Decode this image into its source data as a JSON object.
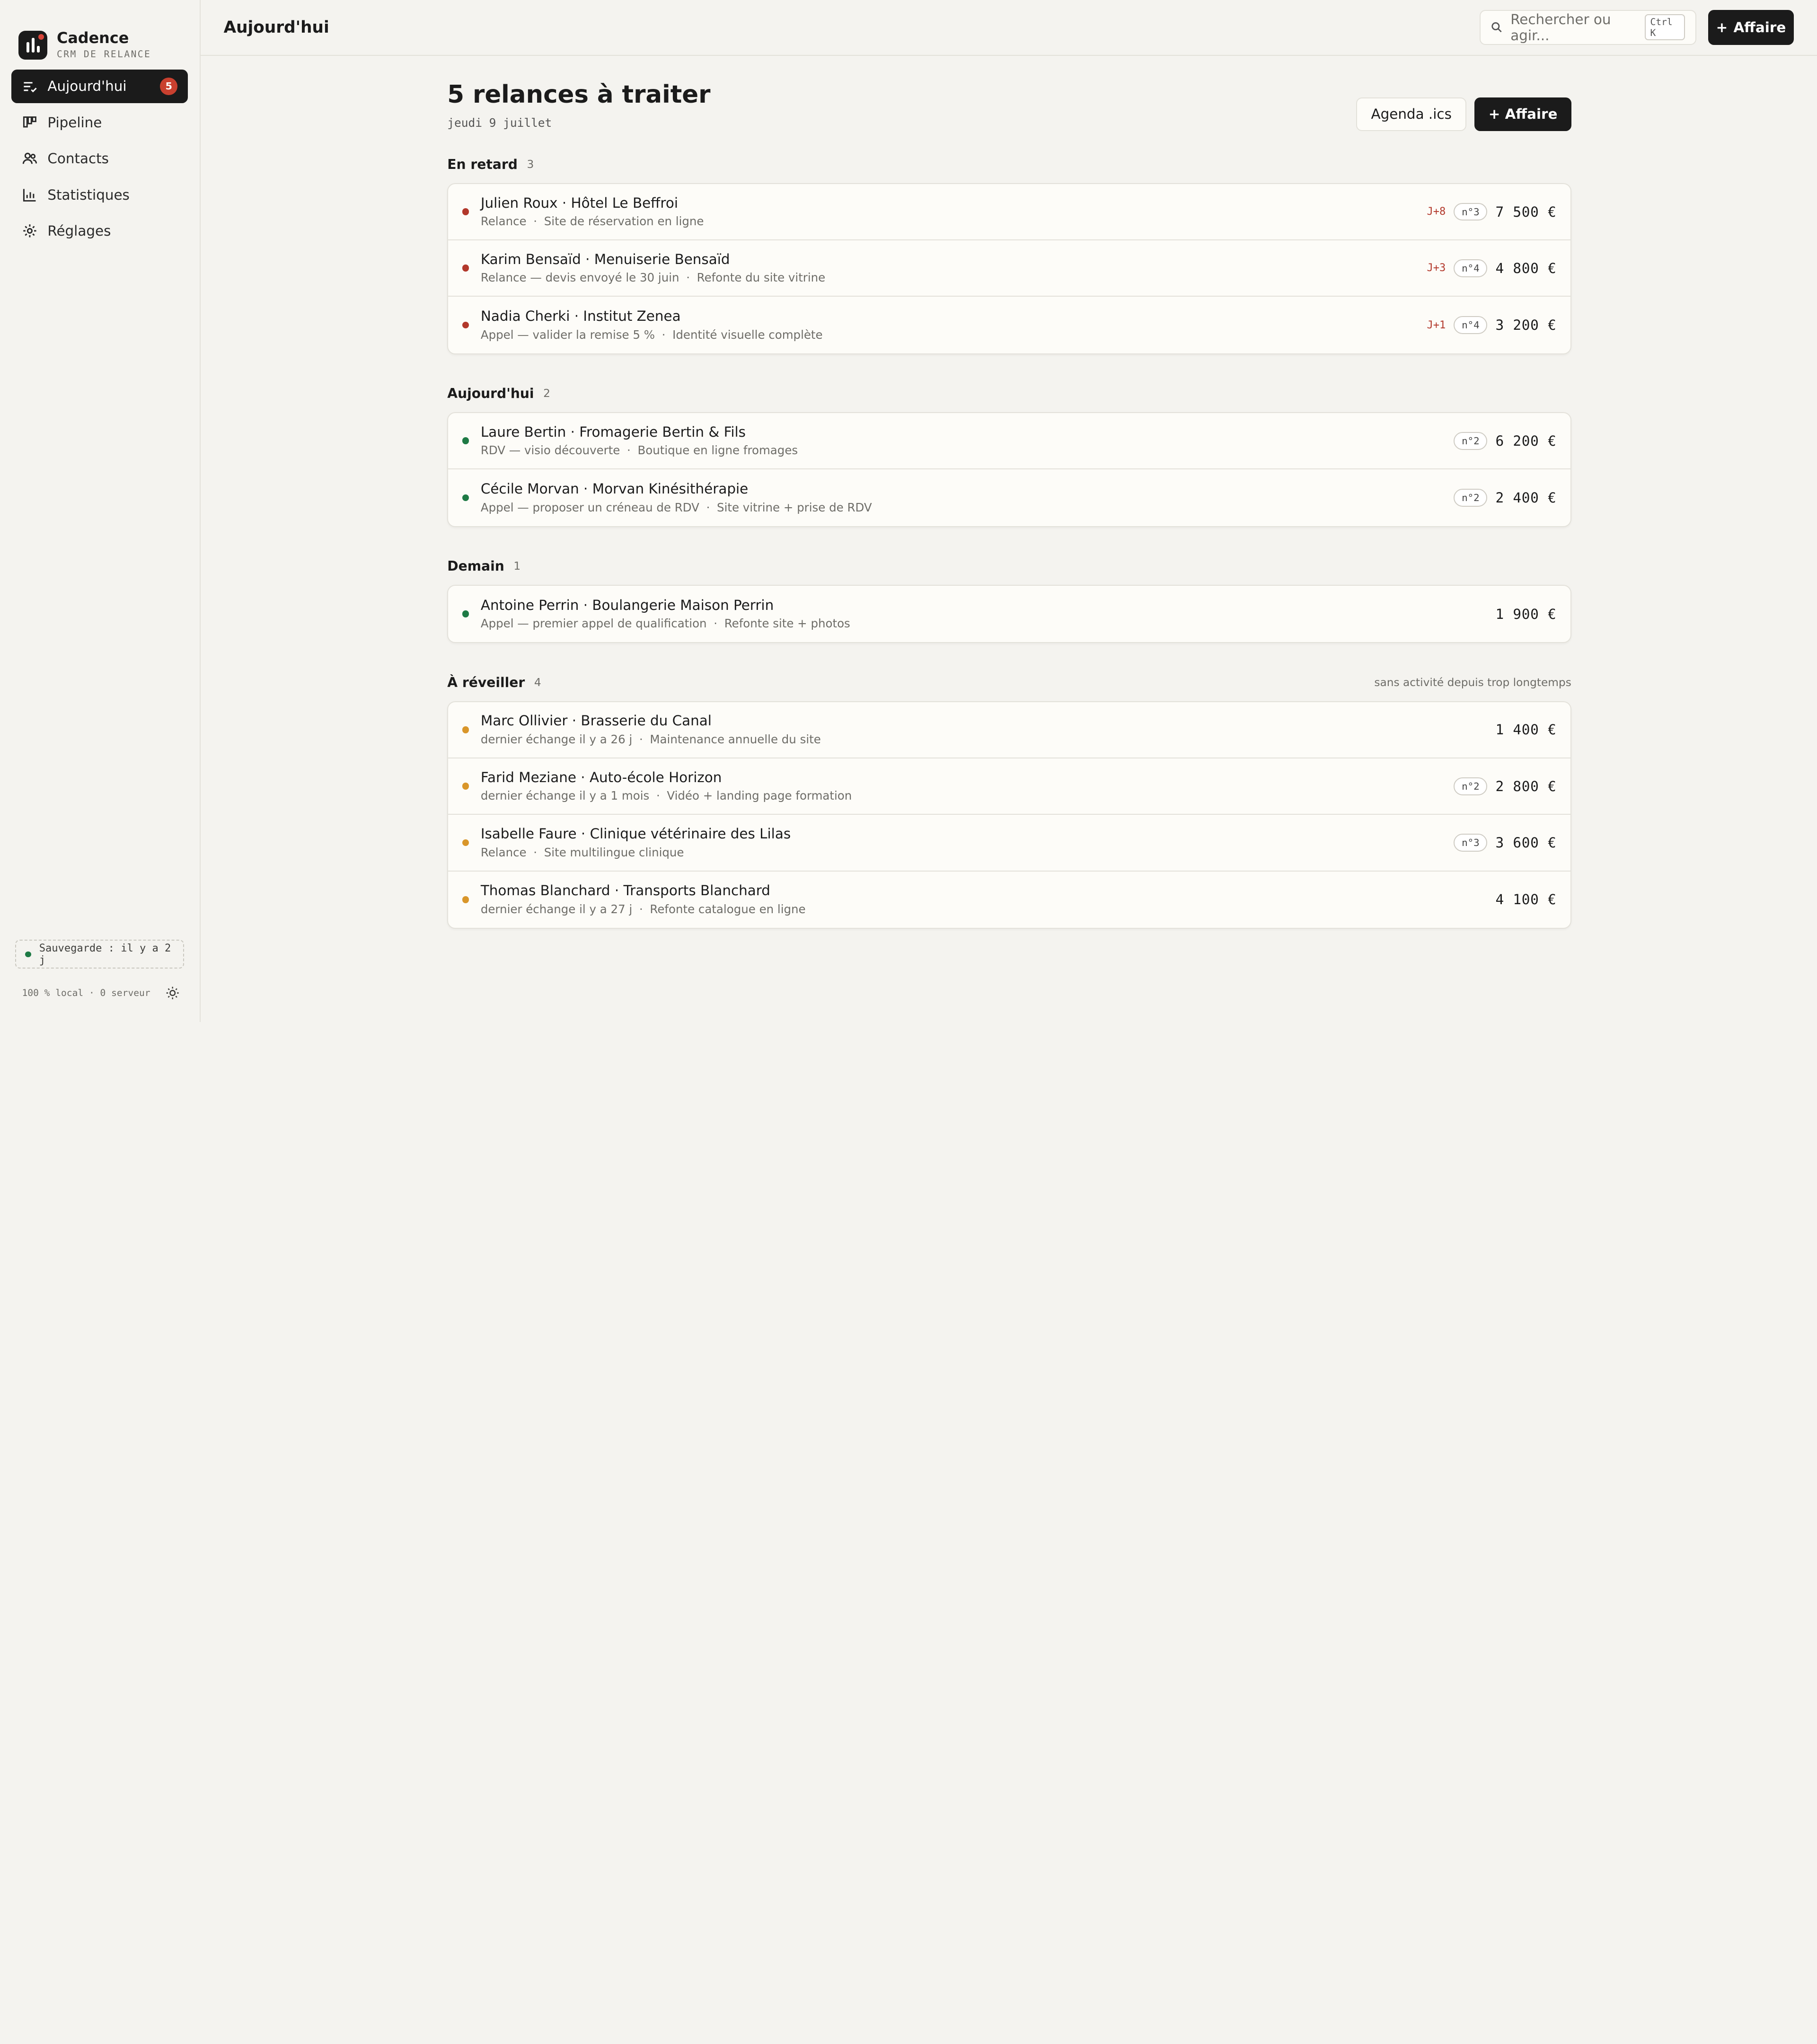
{
  "brand": {
    "name": "Cadence",
    "subtitle": "CRM DE RELANCE"
  },
  "nav": [
    {
      "label": "Aujourd'hui",
      "icon": "list-check-icon",
      "active": true,
      "badge": "5"
    },
    {
      "label": "Pipeline",
      "icon": "kanban-icon"
    },
    {
      "label": "Contacts",
      "icon": "users-icon"
    },
    {
      "label": "Statistiques",
      "icon": "bar-chart-icon"
    },
    {
      "label": "Réglages",
      "icon": "gear-icon"
    }
  ],
  "sidebar_footer": {
    "save_status": "Sauvegarde : il y a 2 j",
    "local_info": "100 % local · 0 serveur"
  },
  "topbar": {
    "title": "Aujourd'hui",
    "search_placeholder": "Rechercher ou agir...",
    "search_shortcut": "Ctrl K",
    "add_button": "Affaire"
  },
  "page": {
    "title": "5 relances à traiter",
    "date": "jeudi 9 juillet",
    "agenda_button": "Agenda .ics",
    "add_button": "+ Affaire"
  },
  "colors": {
    "overdue": "#b2382b",
    "today": "#1e7a45",
    "wake": "#d9962a"
  },
  "sections": [
    {
      "title": "En retard",
      "count": "3",
      "note": "",
      "rows": [
        {
          "title": "Julien Roux · Hôtel Le Beffroi",
          "action": "Relance",
          "project": "Site de réservation en ligne",
          "delay": "J+8",
          "step": "n°3",
          "amount": "7 500 €",
          "dot": "#b2382b"
        },
        {
          "title": "Karim Bensaïd · Menuiserie Bensaïd",
          "action": "Relance — devis envoyé le 30 juin",
          "project": "Refonte du site vitrine",
          "delay": "J+3",
          "step": "n°4",
          "amount": "4 800 €",
          "dot": "#b2382b"
        },
        {
          "title": "Nadia Cherki · Institut Zenea",
          "action": "Appel — valider la remise 5 %",
          "project": "Identité visuelle complète",
          "delay": "J+1",
          "step": "n°4",
          "amount": "3 200 €",
          "dot": "#b2382b"
        }
      ]
    },
    {
      "title": "Aujourd'hui",
      "count": "2",
      "note": "",
      "rows": [
        {
          "title": "Laure Bertin · Fromagerie Bertin & Fils",
          "action": "RDV — visio découverte",
          "project": "Boutique en ligne fromages",
          "delay": "",
          "step": "n°2",
          "amount": "6 200 €",
          "dot": "#1e7a45"
        },
        {
          "title": "Cécile Morvan · Morvan Kinésithérapie",
          "action": "Appel — proposer un créneau de RDV",
          "project": "Site vitrine + prise de RDV",
          "delay": "",
          "step": "n°2",
          "amount": "2 400 €",
          "dot": "#1e7a45"
        }
      ]
    },
    {
      "title": "Demain",
      "count": "1",
      "note": "",
      "rows": [
        {
          "title": "Antoine Perrin · Boulangerie Maison Perrin",
          "action": "Appel — premier appel de qualification",
          "project": "Refonte site + photos",
          "delay": "",
          "step": "",
          "amount": "1 900 €",
          "dot": "#1e7a45"
        }
      ]
    },
    {
      "title": "À réveiller",
      "count": "4",
      "note": "sans activité depuis trop longtemps",
      "rows": [
        {
          "title": "Marc Ollivier · Brasserie du Canal",
          "action": "dernier échange il y a 26 j",
          "project": "Maintenance annuelle du site",
          "delay": "",
          "step": "",
          "amount": "1 400 €",
          "dot": "#d9962a"
        },
        {
          "title": "Farid Meziane · Auto-école Horizon",
          "action": "dernier échange il y a 1 mois",
          "project": "Vidéo + landing page formation",
          "delay": "",
          "step": "n°2",
          "amount": "2 800 €",
          "dot": "#d9962a"
        },
        {
          "title": "Isabelle Faure · Clinique vétérinaire des Lilas",
          "action": "Relance",
          "project": "Site multilingue clinique",
          "delay": "",
          "step": "n°3",
          "amount": "3 600 €",
          "dot": "#d9962a"
        },
        {
          "title": "Thomas Blanchard · Transports Blanchard",
          "action": "dernier échange il y a 27 j",
          "project": "Refonte catalogue en ligne",
          "delay": "",
          "step": "",
          "amount": "4 100 €",
          "dot": "#d9962a"
        }
      ]
    }
  ]
}
